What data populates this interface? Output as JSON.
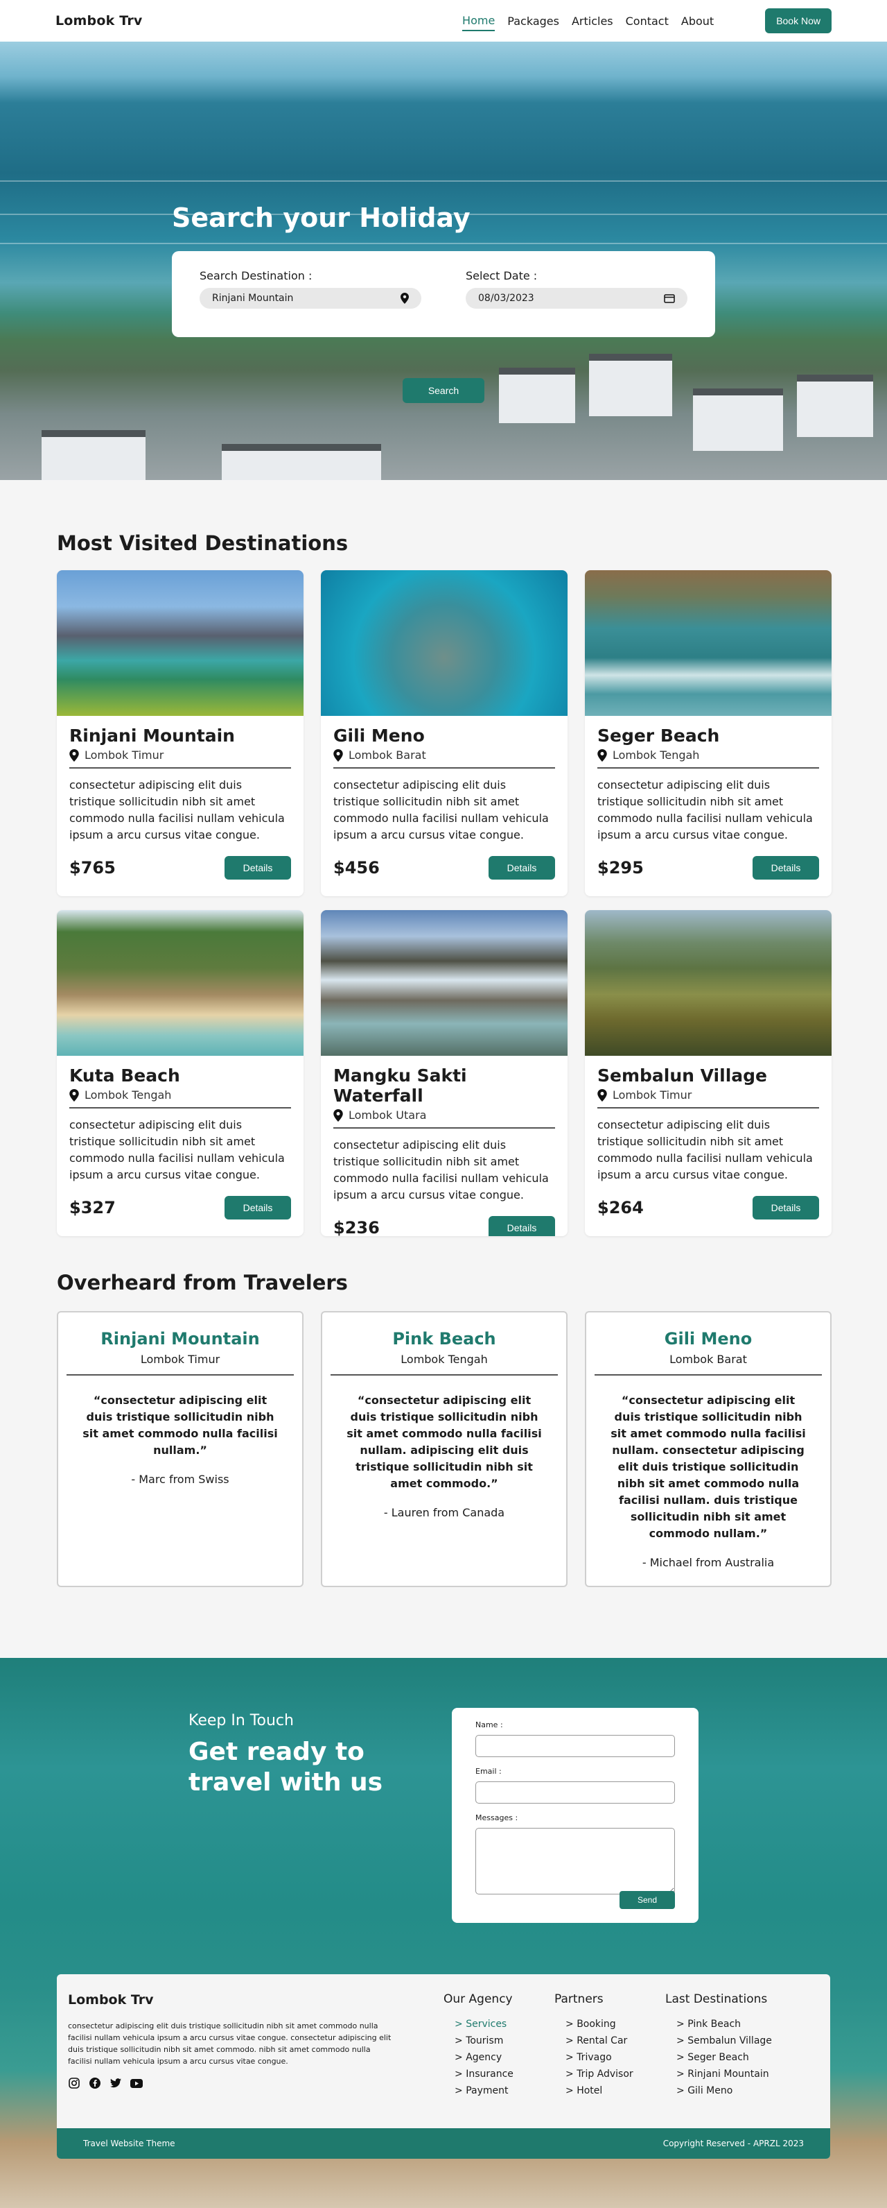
{
  "nav": {
    "brand": "Lombok Trv",
    "links": [
      "Home",
      "Packages",
      "Articles",
      "Contact",
      "About"
    ],
    "book_label": "Book Now"
  },
  "hero": {
    "title": "Search your Holiday",
    "destination_label": "Search Destination :",
    "destination_value": "Rinjani Mountain",
    "date_label": "Select Date :",
    "date_value": "08/03/2023",
    "search_label": "Search"
  },
  "destinations": {
    "title": "Most Visited Destinations",
    "details_label": "Details",
    "items": [
      {
        "name": "Rinjani Mountain",
        "location": "Lombok Timur",
        "text": "consectetur adipiscing elit duis tristique sollicitudin nibh sit amet commodo nulla facilisi nullam vehicula ipsum a arcu cursus vitae congue.",
        "price": "$765"
      },
      {
        "name": "Gili Meno",
        "location": "Lombok Barat",
        "text": "consectetur adipiscing elit duis tristique sollicitudin nibh sit amet commodo nulla facilisi nullam vehicula ipsum a arcu cursus vitae congue.",
        "price": "$456"
      },
      {
        "name": "Seger Beach",
        "location": "Lombok Tengah",
        "text": "consectetur adipiscing elit duis tristique sollicitudin nibh sit amet commodo nulla facilisi nullam vehicula ipsum a arcu cursus vitae congue.",
        "price": "$295"
      },
      {
        "name": "Kuta Beach",
        "location": "Lombok Tengah",
        "text": "consectetur adipiscing elit duis tristique sollicitudin nibh sit amet commodo nulla facilisi nullam vehicula ipsum a arcu cursus vitae congue.",
        "price": "$327"
      },
      {
        "name": "Mangku Sakti Waterfall",
        "location": "Lombok Utara",
        "text": "consectetur adipiscing elit duis tristique sollicitudin nibh sit amet commodo nulla facilisi nullam vehicula ipsum a arcu cursus vitae congue.",
        "price": "$236"
      },
      {
        "name": "Sembalun Village",
        "location": "Lombok Timur",
        "text": "consectetur adipiscing elit duis tristique sollicitudin nibh sit amet commodo nulla facilisi nullam vehicula ipsum a arcu cursus vitae congue.",
        "price": "$264"
      }
    ]
  },
  "reviews": {
    "title": "Overheard from Travelers",
    "items": [
      {
        "place": "Rinjani Mountain",
        "location": "Lombok Timur",
        "quote": "“consectetur adipiscing elit duis tristique sollicitudin nibh sit amet commodo nulla facilisi nullam.”",
        "author": "- Marc from Swiss"
      },
      {
        "place": "Pink Beach",
        "location": "Lombok Tengah",
        "quote": "“consectetur adipiscing elit duis tristique sollicitudin nibh sit amet commodo nulla facilisi nullam. adipiscing elit duis tristique sollicitudin nibh sit amet commodo.”",
        "author": "- Lauren from Canada"
      },
      {
        "place": "Gili Meno",
        "location": "Lombok Barat",
        "quote": "“consectetur adipiscing elit duis tristique sollicitudin nibh sit amet commodo nulla facilisi nullam. consectetur adipiscing elit duis tristique sollicitudin nibh sit amet commodo nulla facilisi nullam. duis tristique sollicitudin nibh sit amet commodo nullam.”",
        "author": "- Michael from Australia"
      }
    ]
  },
  "contact": {
    "kicker": "Keep In Touch",
    "headline": "Get ready to travel with us",
    "name_label": "Name :",
    "email_label": "Email :",
    "messages_label": "Messages :",
    "send_label": "Send"
  },
  "footer": {
    "brand": "Lombok Trv",
    "text": "consectetur adipiscing elit duis tristique sollicitudin nibh sit amet commodo nulla facilisi nullam vehicula ipsum a arcu cursus vitae congue. consectetur adipiscing elit duis tristique sollicitudin nibh sit amet commodo. nibh sit amet commodo nulla facilisi nullam vehicula ipsum a arcu cursus vitae congue.",
    "socials": [
      "instagram-icon",
      "facebook-icon",
      "twitter-icon",
      "youtube-icon"
    ],
    "columns": [
      {
        "title": "Our Agency",
        "items": [
          "Services",
          "Tourism",
          "Agency",
          "Insurance",
          "Payment"
        ]
      },
      {
        "title": "Partners",
        "items": [
          "Booking",
          "Rental Car",
          "Trivago",
          "Trip Advisor",
          "Hotel"
        ]
      },
      {
        "title": "Last Destinations",
        "items": [
          "Pink Beach",
          "Sembalun Village",
          "Seger Beach",
          "Rinjani Mountain",
          "Gili Meno"
        ]
      }
    ],
    "bottom_left": "Travel Website Theme",
    "bottom_right": "Copyright Reserved - APRZL 2023"
  },
  "colors": {
    "accent": "#1f7a6d",
    "background": "#f5f5f5"
  }
}
